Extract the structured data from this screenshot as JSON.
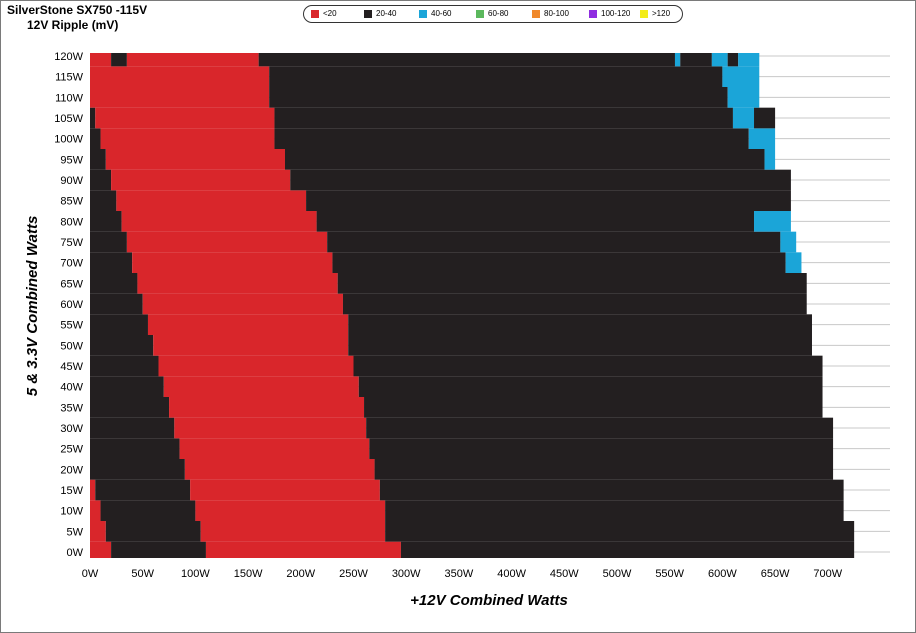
{
  "title": "SilverStone SX750 -115V",
  "subtitle": "12V Ripple (mV)",
  "legend": [
    {
      "label": "<20",
      "color": "#d9262b"
    },
    {
      "label": "20-40",
      "color": "#231f20"
    },
    {
      "label": "40-60",
      "color": "#1ba5d8"
    },
    {
      "label": "60-80",
      "color": "#5bb85d"
    },
    {
      "label": "80-100",
      "color": "#f0892c"
    },
    {
      "label": "100-120",
      "color": "#8f2de0"
    },
    {
      "label": ">120",
      "color": "#f3ec19"
    }
  ],
  "chart_data": {
    "type": "heatmap",
    "title": "SilverStone SX750 -115V",
    "subtitle": "12V Ripple (mV)",
    "xlabel": "+12V Combined Watts",
    "ylabel": "5 & 3.3V Combined Watts",
    "x_tick_labels": [
      "0W",
      "50W",
      "100W",
      "150W",
      "200W",
      "250W",
      "300W",
      "350W",
      "400W",
      "450W",
      "500W",
      "550W",
      "600W",
      "650W",
      "700W"
    ],
    "y_tick_labels": [
      "0W",
      "5W",
      "10W",
      "15W",
      "20W",
      "25W",
      "30W",
      "35W",
      "40W",
      "45W",
      "50W",
      "55W",
      "60W",
      "65W",
      "70W",
      "75W",
      "80W",
      "85W",
      "90W",
      "95W",
      "100W",
      "105W",
      "110W",
      "115W",
      "120W"
    ],
    "xlim": [
      0,
      720
    ],
    "ylim": [
      0,
      120
    ],
    "grid": true,
    "legend_position": "top",
    "categories": [
      "<20",
      "20-40",
      "40-60",
      "60-80",
      "80-100",
      "100-120",
      ">120"
    ],
    "rows": [
      {
        "y": 0,
        "max_x": 725,
        "runs": [
          [
            0,
            "<20"
          ],
          [
            20,
            "20-40"
          ],
          [
            110,
            "<20"
          ],
          [
            295,
            "20-40"
          ]
        ]
      },
      {
        "y": 5,
        "max_x": 725,
        "runs": [
          [
            0,
            "<20"
          ],
          [
            15,
            "20-40"
          ],
          [
            105,
            "<20"
          ],
          [
            280,
            "20-40"
          ]
        ]
      },
      {
        "y": 10,
        "max_x": 715,
        "runs": [
          [
            0,
            "<20"
          ],
          [
            10,
            "20-40"
          ],
          [
            100,
            "<20"
          ],
          [
            280,
            "20-40"
          ]
        ]
      },
      {
        "y": 15,
        "max_x": 715,
        "runs": [
          [
            0,
            "<20"
          ],
          [
            5,
            "20-40"
          ],
          [
            95,
            "<20"
          ],
          [
            275,
            "20-40"
          ]
        ]
      },
      {
        "y": 20,
        "max_x": 705,
        "runs": [
          [
            0,
            "<20"
          ],
          [
            0,
            "20-40"
          ],
          [
            90,
            "<20"
          ],
          [
            270,
            "20-40"
          ]
        ]
      },
      {
        "y": 25,
        "max_x": 705,
        "runs": [
          [
            0,
            "<20"
          ],
          [
            0,
            "20-40"
          ],
          [
            85,
            "<20"
          ],
          [
            265,
            "20-40"
          ]
        ]
      },
      {
        "y": 30,
        "max_x": 705,
        "runs": [
          [
            0,
            "<20"
          ],
          [
            0,
            "20-40"
          ],
          [
            80,
            "<20"
          ],
          [
            262,
            "20-40"
          ]
        ]
      },
      {
        "y": 35,
        "max_x": 695,
        "runs": [
          [
            0,
            "<20"
          ],
          [
            0,
            "20-40"
          ],
          [
            75,
            "<20"
          ],
          [
            260,
            "20-40"
          ]
        ]
      },
      {
        "y": 40,
        "max_x": 695,
        "runs": [
          [
            0,
            "<20"
          ],
          [
            0,
            "20-40"
          ],
          [
            70,
            "<20"
          ],
          [
            255,
            "20-40"
          ]
        ]
      },
      {
        "y": 45,
        "max_x": 695,
        "runs": [
          [
            0,
            "<20"
          ],
          [
            0,
            "20-40"
          ],
          [
            65,
            "<20"
          ],
          [
            250,
            "20-40"
          ]
        ]
      },
      {
        "y": 50,
        "max_x": 685,
        "runs": [
          [
            0,
            "<20"
          ],
          [
            0,
            "20-40"
          ],
          [
            60,
            "<20"
          ],
          [
            245,
            "20-40"
          ]
        ]
      },
      {
        "y": 55,
        "max_x": 685,
        "runs": [
          [
            0,
            "<20"
          ],
          [
            0,
            "20-40"
          ],
          [
            55,
            "<20"
          ],
          [
            245,
            "20-40"
          ]
        ]
      },
      {
        "y": 60,
        "max_x": 680,
        "runs": [
          [
            0,
            "<20"
          ],
          [
            0,
            "20-40"
          ],
          [
            50,
            "<20"
          ],
          [
            240,
            "20-40"
          ]
        ]
      },
      {
        "y": 65,
        "max_x": 680,
        "runs": [
          [
            0,
            "<20"
          ],
          [
            0,
            "20-40"
          ],
          [
            45,
            "<20"
          ],
          [
            235,
            "20-40"
          ]
        ]
      },
      {
        "y": 70,
        "max_x": 675,
        "runs": [
          [
            0,
            "<20"
          ],
          [
            0,
            "20-40"
          ],
          [
            40,
            "<20"
          ],
          [
            230,
            "20-40"
          ],
          [
            660,
            "40-60"
          ]
        ]
      },
      {
        "y": 75,
        "max_x": 670,
        "runs": [
          [
            0,
            "<20"
          ],
          [
            0,
            "20-40"
          ],
          [
            35,
            "<20"
          ],
          [
            225,
            "20-40"
          ],
          [
            655,
            "40-60"
          ]
        ]
      },
      {
        "y": 80,
        "max_x": 665,
        "runs": [
          [
            0,
            "<20"
          ],
          [
            0,
            "20-40"
          ],
          [
            30,
            "<20"
          ],
          [
            215,
            "20-40"
          ],
          [
            630,
            "40-60"
          ]
        ]
      },
      {
        "y": 85,
        "max_x": 665,
        "runs": [
          [
            0,
            "<20"
          ],
          [
            0,
            "20-40"
          ],
          [
            25,
            "<20"
          ],
          [
            205,
            "20-40"
          ]
        ]
      },
      {
        "y": 90,
        "max_x": 665,
        "runs": [
          [
            0,
            "<20"
          ],
          [
            0,
            "20-40"
          ],
          [
            20,
            "<20"
          ],
          [
            190,
            "20-40"
          ]
        ]
      },
      {
        "y": 95,
        "max_x": 650,
        "runs": [
          [
            0,
            "<20"
          ],
          [
            0,
            "20-40"
          ],
          [
            15,
            "<20"
          ],
          [
            185,
            "20-40"
          ],
          [
            640,
            "40-60"
          ]
        ]
      },
      {
        "y": 100,
        "max_x": 650,
        "runs": [
          [
            0,
            "<20"
          ],
          [
            0,
            "20-40"
          ],
          [
            10,
            "<20"
          ],
          [
            175,
            "20-40"
          ],
          [
            625,
            "40-60"
          ]
        ]
      },
      {
        "y": 105,
        "max_x": 650,
        "runs": [
          [
            0,
            "<20"
          ],
          [
            0,
            "20-40"
          ],
          [
            5,
            "<20"
          ],
          [
            175,
            "20-40"
          ],
          [
            610,
            "40-60"
          ],
          [
            630,
            "20-40"
          ]
        ]
      },
      {
        "y": 110,
        "max_x": 635,
        "runs": [
          [
            0,
            "<20"
          ],
          [
            0,
            "20-40"
          ],
          [
            0,
            "<20"
          ],
          [
            170,
            "20-40"
          ],
          [
            605,
            "40-60"
          ]
        ]
      },
      {
        "y": 115,
        "max_x": 635,
        "runs": [
          [
            0,
            "<20"
          ],
          [
            0,
            "20-40"
          ],
          [
            0,
            "<20"
          ],
          [
            170,
            "20-40"
          ],
          [
            600,
            "40-60"
          ]
        ]
      },
      {
        "y": 120,
        "max_x": 635,
        "runs": [
          [
            0,
            "<20"
          ],
          [
            20,
            "20-40"
          ],
          [
            35,
            "<20"
          ],
          [
            160,
            "20-40"
          ],
          [
            555,
            "40-60"
          ],
          [
            560,
            "20-40"
          ],
          [
            590,
            "40-60"
          ],
          [
            605,
            "20-40"
          ],
          [
            615,
            "40-60"
          ]
        ]
      }
    ]
  }
}
